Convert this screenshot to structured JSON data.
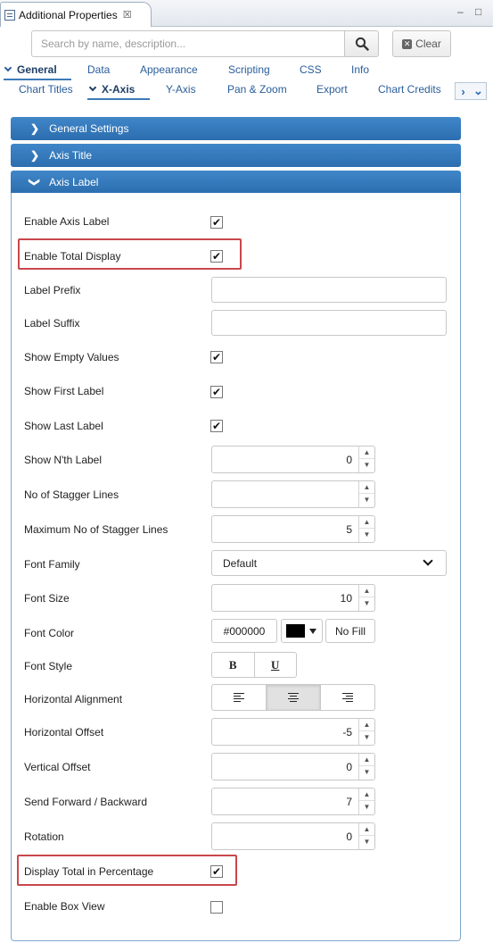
{
  "view_tab": {
    "title": "Additional Properties",
    "close": "☒"
  },
  "window_buttons": {
    "minimize": "–",
    "maximize": "□"
  },
  "search": {
    "placeholder": "Search by name, description...",
    "value": "",
    "clear_label": "Clear"
  },
  "tabs_primary": [
    {
      "label": "General",
      "active": true
    },
    {
      "label": "Data",
      "active": false
    },
    {
      "label": "Appearance",
      "active": false
    },
    {
      "label": "Scripting",
      "active": false
    },
    {
      "label": "CSS",
      "active": false
    },
    {
      "label": "Info",
      "active": false
    }
  ],
  "tabs_secondary": [
    {
      "label": "Chart Titles",
      "active": false
    },
    {
      "label": "X-Axis",
      "active": true
    },
    {
      "label": "Y-Axis",
      "active": false
    },
    {
      "label": "Pan & Zoom",
      "active": false
    },
    {
      "label": "Export",
      "active": false
    },
    {
      "label": "Chart Credits",
      "active": false
    }
  ],
  "sections": {
    "general_settings": "General Settings",
    "axis_title": "Axis Title",
    "axis_label": "Axis Label"
  },
  "form": {
    "enable_axis_label": {
      "label": "Enable Axis Label",
      "checked": true
    },
    "enable_total_display": {
      "label": "Enable Total Display",
      "checked": true
    },
    "label_prefix": {
      "label": "Label Prefix",
      "value": ""
    },
    "label_suffix": {
      "label": "Label Suffix",
      "value": ""
    },
    "show_empty_values": {
      "label": "Show Empty Values",
      "checked": true
    },
    "show_first_label": {
      "label": "Show First Label",
      "checked": true
    },
    "show_last_label": {
      "label": "Show Last Label",
      "checked": true
    },
    "show_nth_label": {
      "label": "Show N'th Label",
      "value": "0"
    },
    "stagger_lines": {
      "label": "No of Stagger Lines",
      "value": ""
    },
    "max_stagger_lines": {
      "label": "Maximum No of Stagger Lines",
      "value": "5"
    },
    "font_family": {
      "label": "Font Family",
      "value": "Default"
    },
    "font_size": {
      "label": "Font Size",
      "value": "10"
    },
    "font_color": {
      "label": "Font Color",
      "hex": "#000000",
      "swatch": "#000000",
      "no_fill": "No Fill"
    },
    "font_style": {
      "label": "Font Style",
      "bold": "B",
      "underline": "U"
    },
    "horizontal_alignment": {
      "label": "Horizontal Alignment",
      "selected": "center"
    },
    "horizontal_offset": {
      "label": "Horizontal Offset",
      "value": "-5"
    },
    "vertical_offset": {
      "label": "Vertical Offset",
      "value": "0"
    },
    "send_forward_backward": {
      "label": "Send Forward / Backward",
      "value": "7"
    },
    "rotation": {
      "label": "Rotation",
      "value": "0"
    },
    "display_total_percentage": {
      "label": "Display Total in Percentage",
      "checked": true
    },
    "enable_box_view": {
      "label": "Enable Box View",
      "checked": false
    }
  },
  "glyphs": {
    "check": "✔",
    "spin_up": "▲",
    "spin_down": "▼",
    "section_collapsed": "❯"
  },
  "colors": {
    "accent": "#2c6eaf",
    "highlight": "#c9474b",
    "link": "#2a5d9a"
  }
}
